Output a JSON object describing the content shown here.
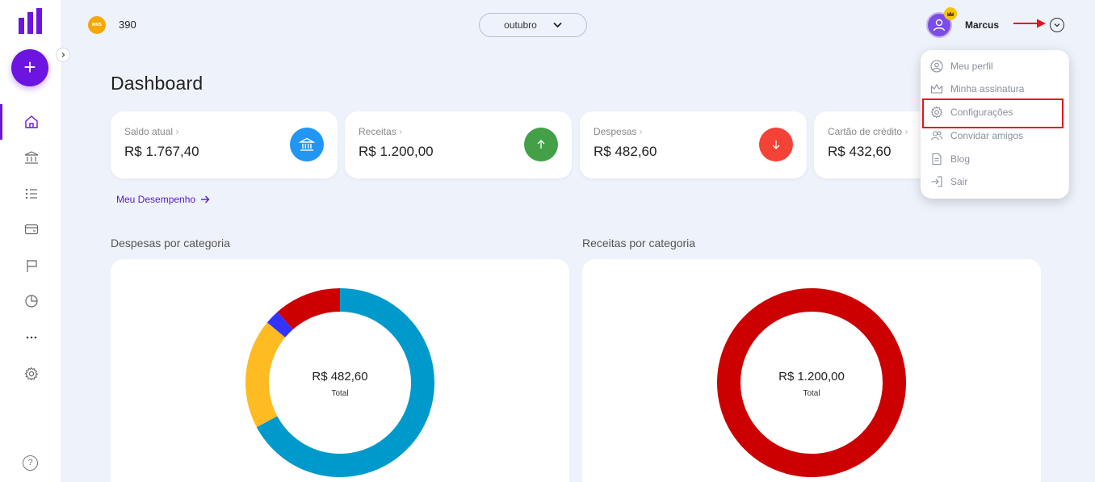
{
  "topbar": {
    "coin_text": "MMS",
    "points": "390",
    "month": "outubro",
    "username": "Marcus"
  },
  "user_menu": {
    "items": [
      {
        "label": "Meu perfil",
        "icon": "user-circle-icon"
      },
      {
        "label": "Minha assinatura",
        "icon": "crown-icon"
      },
      {
        "label": "Configurações",
        "icon": "gear-icon"
      },
      {
        "label": "Convidar amigos",
        "icon": "users-icon"
      },
      {
        "label": "Blog",
        "icon": "document-icon"
      },
      {
        "label": "Sair",
        "icon": "logout-icon"
      }
    ],
    "highlighted": "Configurações"
  },
  "sidebar": {
    "items": [
      "home-icon",
      "bank-icon",
      "list-icon",
      "wallet-icon",
      "flag-icon",
      "pie-chart-icon",
      "more-icon",
      "gear-icon"
    ],
    "help": "?"
  },
  "main": {
    "title": "Dashboard",
    "cards": [
      {
        "label": "Saldo atual",
        "value": "R$ 1.767,40",
        "icon": "bank-icon",
        "color": "#2196f3"
      },
      {
        "label": "Receitas",
        "value": "R$ 1.200,00",
        "icon": "arrow-up-icon",
        "color": "#43a047"
      },
      {
        "label": "Despesas",
        "value": "R$ 482,60",
        "icon": "arrow-down-icon",
        "color": "#f44336"
      },
      {
        "label": "Cartão de crédito",
        "value": "R$ 432,60",
        "icon": "credit-card-icon",
        "color": "#6c14e0"
      }
    ],
    "performance_link": "Meu Desempenho",
    "expenses_title": "Despesas por categoria",
    "income_title": "Receitas por categoria",
    "expenses_total": "R$ 482,60",
    "income_total": "R$ 1.200,00",
    "total_label": "Total"
  },
  "colors": {
    "accent": "#6c14e0",
    "highlight": "#e8131c"
  },
  "chart_data": [
    {
      "type": "pie",
      "title": "Despesas por categoria",
      "total": "R$ 482,60",
      "slices": [
        {
          "value": 0.672,
          "color": "#0099cc"
        },
        {
          "value": 0.188,
          "color": "#ffbb22"
        },
        {
          "value": 0.025,
          "color": "#3333ff"
        },
        {
          "value": 0.115,
          "color": "#cc0000"
        }
      ]
    },
    {
      "type": "pie",
      "title": "Receitas por categoria",
      "total": "R$ 1.200,00",
      "slices": [
        {
          "value": 1.0,
          "color": "#cc0000"
        }
      ]
    }
  ]
}
